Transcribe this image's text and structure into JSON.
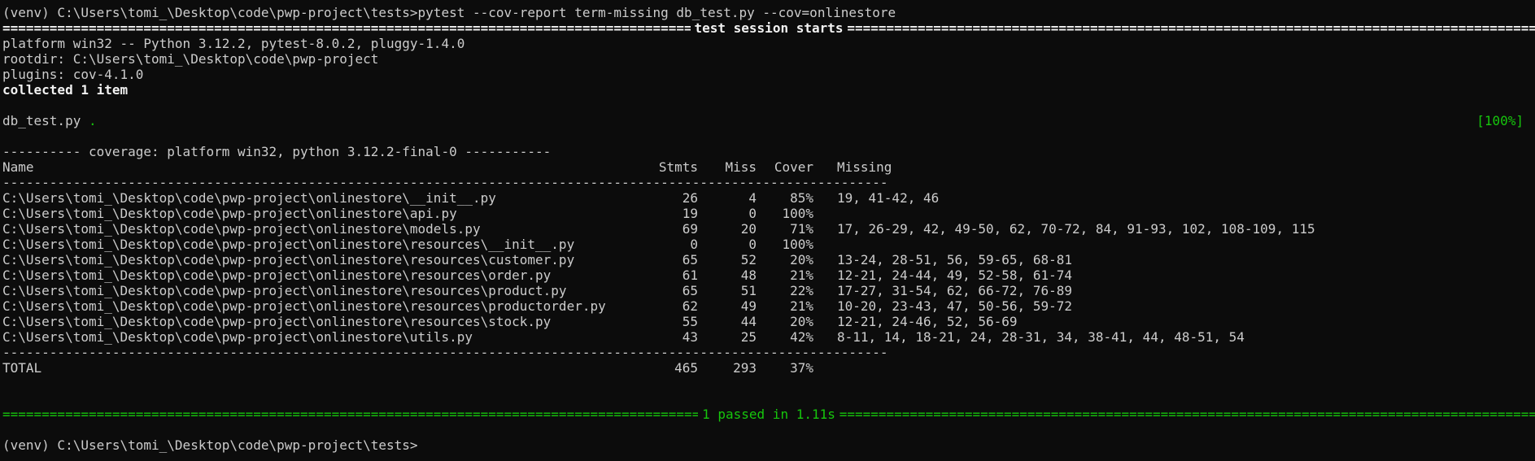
{
  "command_line": "(venv) C:\\Users\\tomi_\\Desktop\\code\\pwp-project\\tests>pytest --cov-report term-missing db_test.py --cov=onlinestore",
  "session_title": "test session starts",
  "platform": "platform win32 -- Python 3.12.2, pytest-8.0.2, pluggy-1.4.0",
  "rootdir": "rootdir: C:\\Users\\tomi_\\Desktop\\code\\pwp-project",
  "plugins": "plugins: cov-4.1.0",
  "collected": "collected 1 item",
  "test_file": "db_test.py",
  "test_dots": ".",
  "progress": "[100%]",
  "coverage_header": "---------- coverage: platform win32, python 3.12.2-final-0 -----------",
  "columns": {
    "name": "Name",
    "stmts": "Stmts",
    "miss": "Miss",
    "cover": "Cover",
    "missing": "Missing"
  },
  "rows": [
    {
      "name": "C:\\Users\\tomi_\\Desktop\\code\\pwp-project\\onlinestore\\__init__.py",
      "stmts": "26",
      "miss": "4",
      "cover": "85%",
      "missing": "19, 41-42, 46"
    },
    {
      "name": "C:\\Users\\tomi_\\Desktop\\code\\pwp-project\\onlinestore\\api.py",
      "stmts": "19",
      "miss": "0",
      "cover": "100%",
      "missing": ""
    },
    {
      "name": "C:\\Users\\tomi_\\Desktop\\code\\pwp-project\\onlinestore\\models.py",
      "stmts": "69",
      "miss": "20",
      "cover": "71%",
      "missing": "17, 26-29, 42, 49-50, 62, 70-72, 84, 91-93, 102, 108-109, 115"
    },
    {
      "name": "C:\\Users\\tomi_\\Desktop\\code\\pwp-project\\onlinestore\\resources\\__init__.py",
      "stmts": "0",
      "miss": "0",
      "cover": "100%",
      "missing": ""
    },
    {
      "name": "C:\\Users\\tomi_\\Desktop\\code\\pwp-project\\onlinestore\\resources\\customer.py",
      "stmts": "65",
      "miss": "52",
      "cover": "20%",
      "missing": "13-24, 28-51, 56, 59-65, 68-81"
    },
    {
      "name": "C:\\Users\\tomi_\\Desktop\\code\\pwp-project\\onlinestore\\resources\\order.py",
      "stmts": "61",
      "miss": "48",
      "cover": "21%",
      "missing": "12-21, 24-44, 49, 52-58, 61-74"
    },
    {
      "name": "C:\\Users\\tomi_\\Desktop\\code\\pwp-project\\onlinestore\\resources\\product.py",
      "stmts": "65",
      "miss": "51",
      "cover": "22%",
      "missing": "17-27, 31-54, 62, 66-72, 76-89"
    },
    {
      "name": "C:\\Users\\tomi_\\Desktop\\code\\pwp-project\\onlinestore\\resources\\productorder.py",
      "stmts": "62",
      "miss": "49",
      "cover": "21%",
      "missing": "10-20, 23-43, 47, 50-56, 59-72"
    },
    {
      "name": "C:\\Users\\tomi_\\Desktop\\code\\pwp-project\\onlinestore\\resources\\stock.py",
      "stmts": "55",
      "miss": "44",
      "cover": "20%",
      "missing": "12-21, 24-46, 52, 56-69"
    },
    {
      "name": "C:\\Users\\tomi_\\Desktop\\code\\pwp-project\\onlinestore\\utils.py",
      "stmts": "43",
      "miss": "25",
      "cover": "42%",
      "missing": "8-11, 14, 18-21, 24, 28-31, 34, 38-41, 44, 48-51, 54"
    }
  ],
  "total": {
    "name": "TOTAL",
    "stmts": "465",
    "miss": "293",
    "cover": "37%"
  },
  "summary": "1 passed in 1.11s",
  "prompt": "(venv) C:\\Users\\tomi_\\Desktop\\code\\pwp-project\\tests>",
  "colors": {
    "background": "#0c0c0c",
    "text": "#cccccc",
    "success": "#16c60c"
  }
}
